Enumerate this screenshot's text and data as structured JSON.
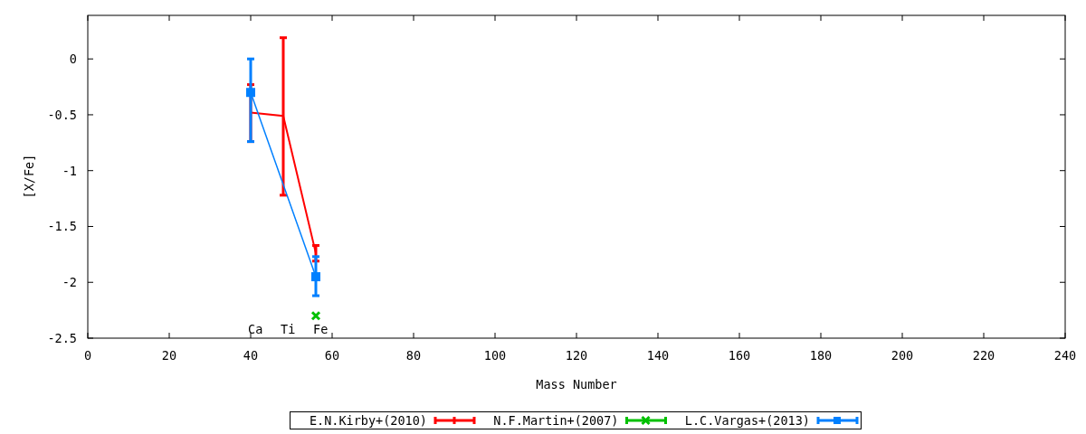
{
  "chart": {
    "chart_data": {
      "type": "line",
      "xlabel": "Mass Number",
      "ylabel": "[X/Fe]",
      "x": [
        40,
        48,
        56
      ],
      "xlim": [
        0,
        240
      ],
      "ylim": [
        -2.5,
        0.39
      ],
      "xticks": [
        0,
        20,
        40,
        60,
        80,
        100,
        120,
        140,
        160,
        180,
        200,
        220,
        240
      ],
      "yticks": [
        0,
        -0.5,
        -1,
        -1.5,
        -2,
        -2.5
      ],
      "legend": "bottom",
      "series": [
        {
          "name": "E.N.Kirby+(2010)",
          "color": "#ff0000",
          "marker": "none",
          "values": [
            -0.48,
            -0.51,
            -1.74
          ],
          "errors": [
            [
              -0.74,
              -0.23
            ],
            [
              -1.22,
              0.19
            ],
            [
              -1.81,
              -1.67
            ]
          ]
        },
        {
          "name": "N.F.Martin+(2007)",
          "color": "#00c000",
          "marker": "cross",
          "values": [
            null,
            null,
            -2.3
          ]
        },
        {
          "name": "L.C.Vargas+(2013)",
          "color": "#0080ff",
          "marker": "square",
          "values": [
            -0.3,
            null,
            -1.95
          ],
          "errors": [
            [
              -0.74,
              0
            ],
            null,
            [
              -2.12,
              -1.77
            ]
          ]
        }
      ],
      "annotations": [
        "Ca",
        "Ti",
        "Fe"
      ]
    }
  }
}
